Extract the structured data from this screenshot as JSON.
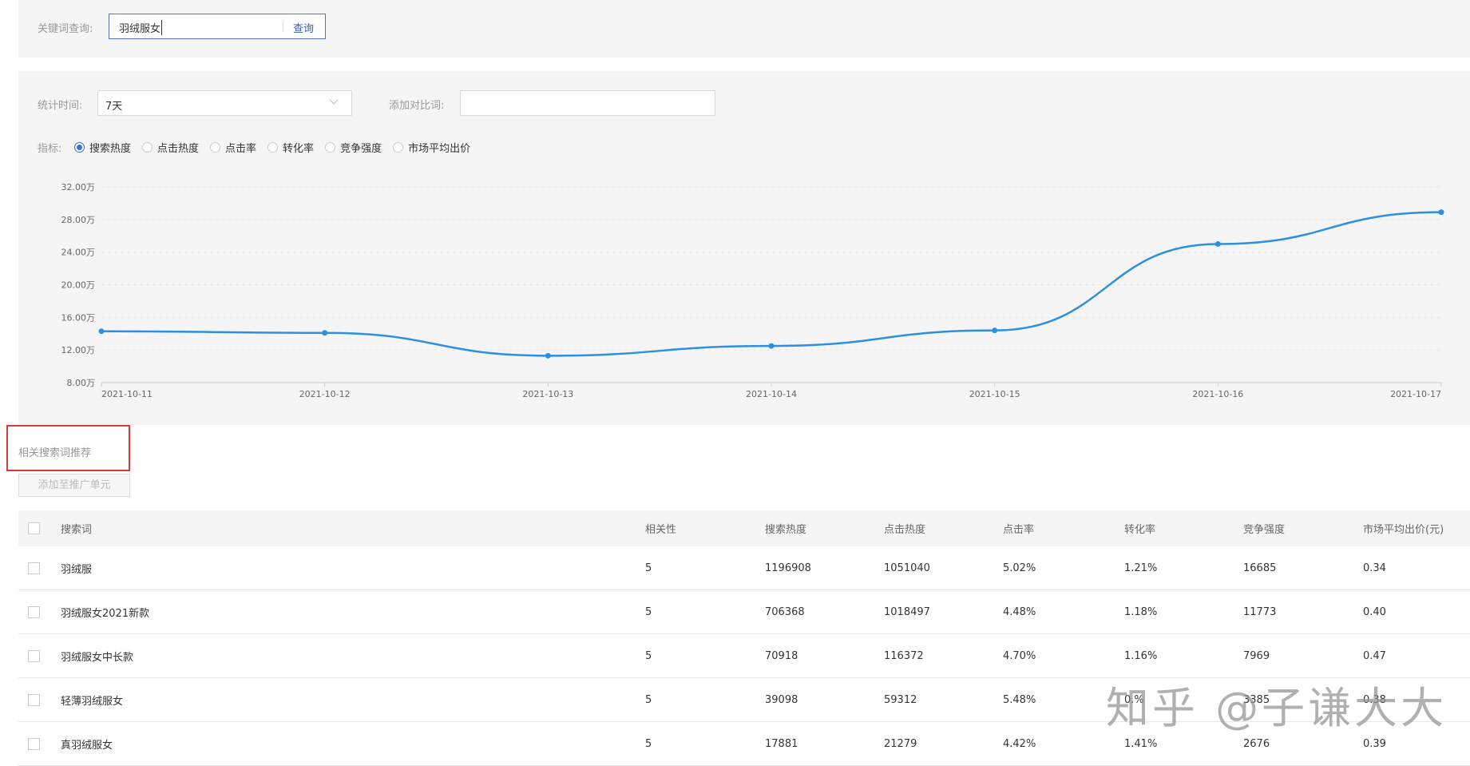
{
  "search": {
    "label": "关键词查询:",
    "value": "羽绒服女",
    "button": "查询"
  },
  "filters": {
    "time_label": "统计时间:",
    "time_value": "7天",
    "compare_label": "添加对比词:",
    "compare_value": "",
    "metric_label": "指标:",
    "metrics": [
      {
        "label": "搜索热度",
        "selected": true
      },
      {
        "label": "点击热度",
        "selected": false
      },
      {
        "label": "点击率",
        "selected": false
      },
      {
        "label": "转化率",
        "selected": false
      },
      {
        "label": "竞争强度",
        "selected": false
      },
      {
        "label": "市场平均出价",
        "selected": false
      }
    ]
  },
  "chart_data": {
    "type": "line",
    "x": [
      "2021-10-11",
      "2021-10-12",
      "2021-10-13",
      "2021-10-14",
      "2021-10-15",
      "2021-10-16",
      "2021-10-17"
    ],
    "series": [
      {
        "name": "搜索热度",
        "values": [
          14.3,
          14.1,
          11.3,
          12.5,
          14.4,
          25.0,
          28.9
        ]
      }
    ],
    "yticks": [
      "8.00万",
      "12.00万",
      "16.00万",
      "20.00万",
      "24.00万",
      "28.00万",
      "32.00万"
    ],
    "ylim": [
      8,
      32
    ],
    "yunit": "万",
    "grid": true,
    "color": "#2d8fe0"
  },
  "related": {
    "title": "相关搜索词推荐",
    "add_button": "添加至推广单元",
    "columns": [
      "搜索词",
      "相关性",
      "搜索热度",
      "点击热度",
      "点击率",
      "转化率",
      "竞争强度",
      "市场平均出价(元)"
    ],
    "rows": [
      [
        "羽绒服",
        "5",
        "1196908",
        "1051040",
        "5.02%",
        "1.21%",
        "16685",
        "0.34"
      ],
      [
        "羽绒服女2021新款",
        "5",
        "706368",
        "1018497",
        "4.48%",
        "1.18%",
        "11773",
        "0.40"
      ],
      [
        "羽绒服女中长款",
        "5",
        "70918",
        "116372",
        "4.70%",
        "1.16%",
        "7969",
        "0.47"
      ],
      [
        "轻薄羽绒服女",
        "5",
        "39098",
        "59312",
        "5.48%",
        "0.%",
        "3385",
        "0.38"
      ],
      [
        "真羽绒服女",
        "5",
        "17881",
        "21279",
        "4.42%",
        "1.41%",
        "2676",
        "0.39"
      ]
    ]
  },
  "watermark": "知乎 @子谦大大"
}
